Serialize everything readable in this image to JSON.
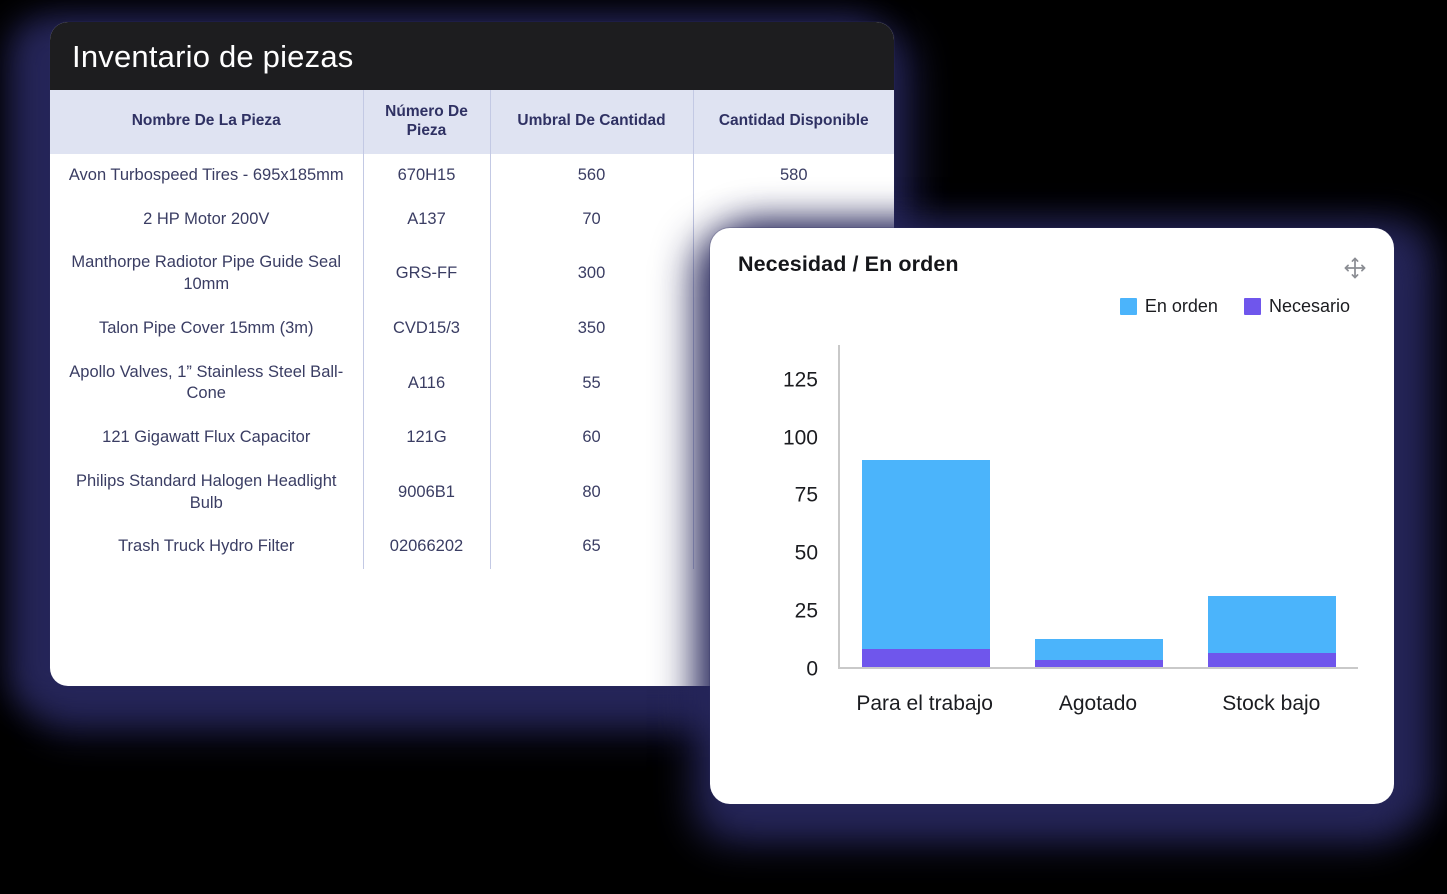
{
  "inventory_card": {
    "title": "Inventario de piezas",
    "columns": [
      "Nombre De La Pieza",
      "Número De Pieza",
      "Umbral De Cantidad",
      "Cantidad Disponible"
    ],
    "rows": [
      {
        "name": "Avon Turbospeed Tires - 695x185mm",
        "number": "670H15",
        "threshold": "560",
        "available": "580"
      },
      {
        "name": "2 HP Motor 200V",
        "number": "A137",
        "threshold": "70",
        "available": ""
      },
      {
        "name": "Manthorpe Radiotor Pipe Guide Seal 10mm",
        "number": "GRS-FF",
        "threshold": "300",
        "available": ""
      },
      {
        "name": "Talon Pipe Cover 15mm (3m)",
        "number": "CVD15/3",
        "threshold": "350",
        "available": ""
      },
      {
        "name": "Apollo Valves, 1” Stainless Steel Ball-Cone",
        "number": "A116",
        "threshold": "55",
        "available": ""
      },
      {
        "name": "121 Gigawatt Flux Capacitor",
        "number": "121G",
        "threshold": "60",
        "available": ""
      },
      {
        "name": "Philips Standard Halogen Headlight Bulb",
        "number": "9006B1",
        "threshold": "80",
        "available": ""
      },
      {
        "name": "Trash Truck Hydro Filter",
        "number": "02066202",
        "threshold": "65",
        "available": ""
      }
    ]
  },
  "chart_card": {
    "title": "Necesidad / En orden",
    "move_handle_icon": "move-arrows-icon"
  },
  "chart_data": {
    "type": "bar",
    "stacked": true,
    "title": "Necesidad / En orden",
    "xlabel": "",
    "ylabel": "",
    "categories": [
      "Para el trabajo",
      "Agotado",
      "Stock bajo"
    ],
    "series": [
      {
        "name": "Necesario",
        "color": "#6f56ec",
        "values": [
          8,
          3,
          6
        ]
      },
      {
        "name": "En orden",
        "color": "#4bb4fb",
        "values": [
          82,
          9,
          25
        ]
      }
    ],
    "stack_totals": [
      90,
      12,
      31
    ],
    "ylim": [
      0,
      140
    ],
    "yticks": [
      0,
      25,
      50,
      75,
      100,
      125
    ],
    "ytick_labels": [
      "0",
      "25",
      "50",
      "75",
      "100",
      "125"
    ],
    "grid": false,
    "legend_position": "top-right",
    "legend_entries": [
      "En orden",
      "Necesario"
    ]
  },
  "colors": {
    "en_orden": "#4bb4fb",
    "necesario": "#6f56ec",
    "titlebar_bg": "#1d1d1f",
    "table_header_bg": "#dfe3f2",
    "table_text": "#3a3d63",
    "divider": "#c3c9e4",
    "shadow": "#26265a"
  }
}
